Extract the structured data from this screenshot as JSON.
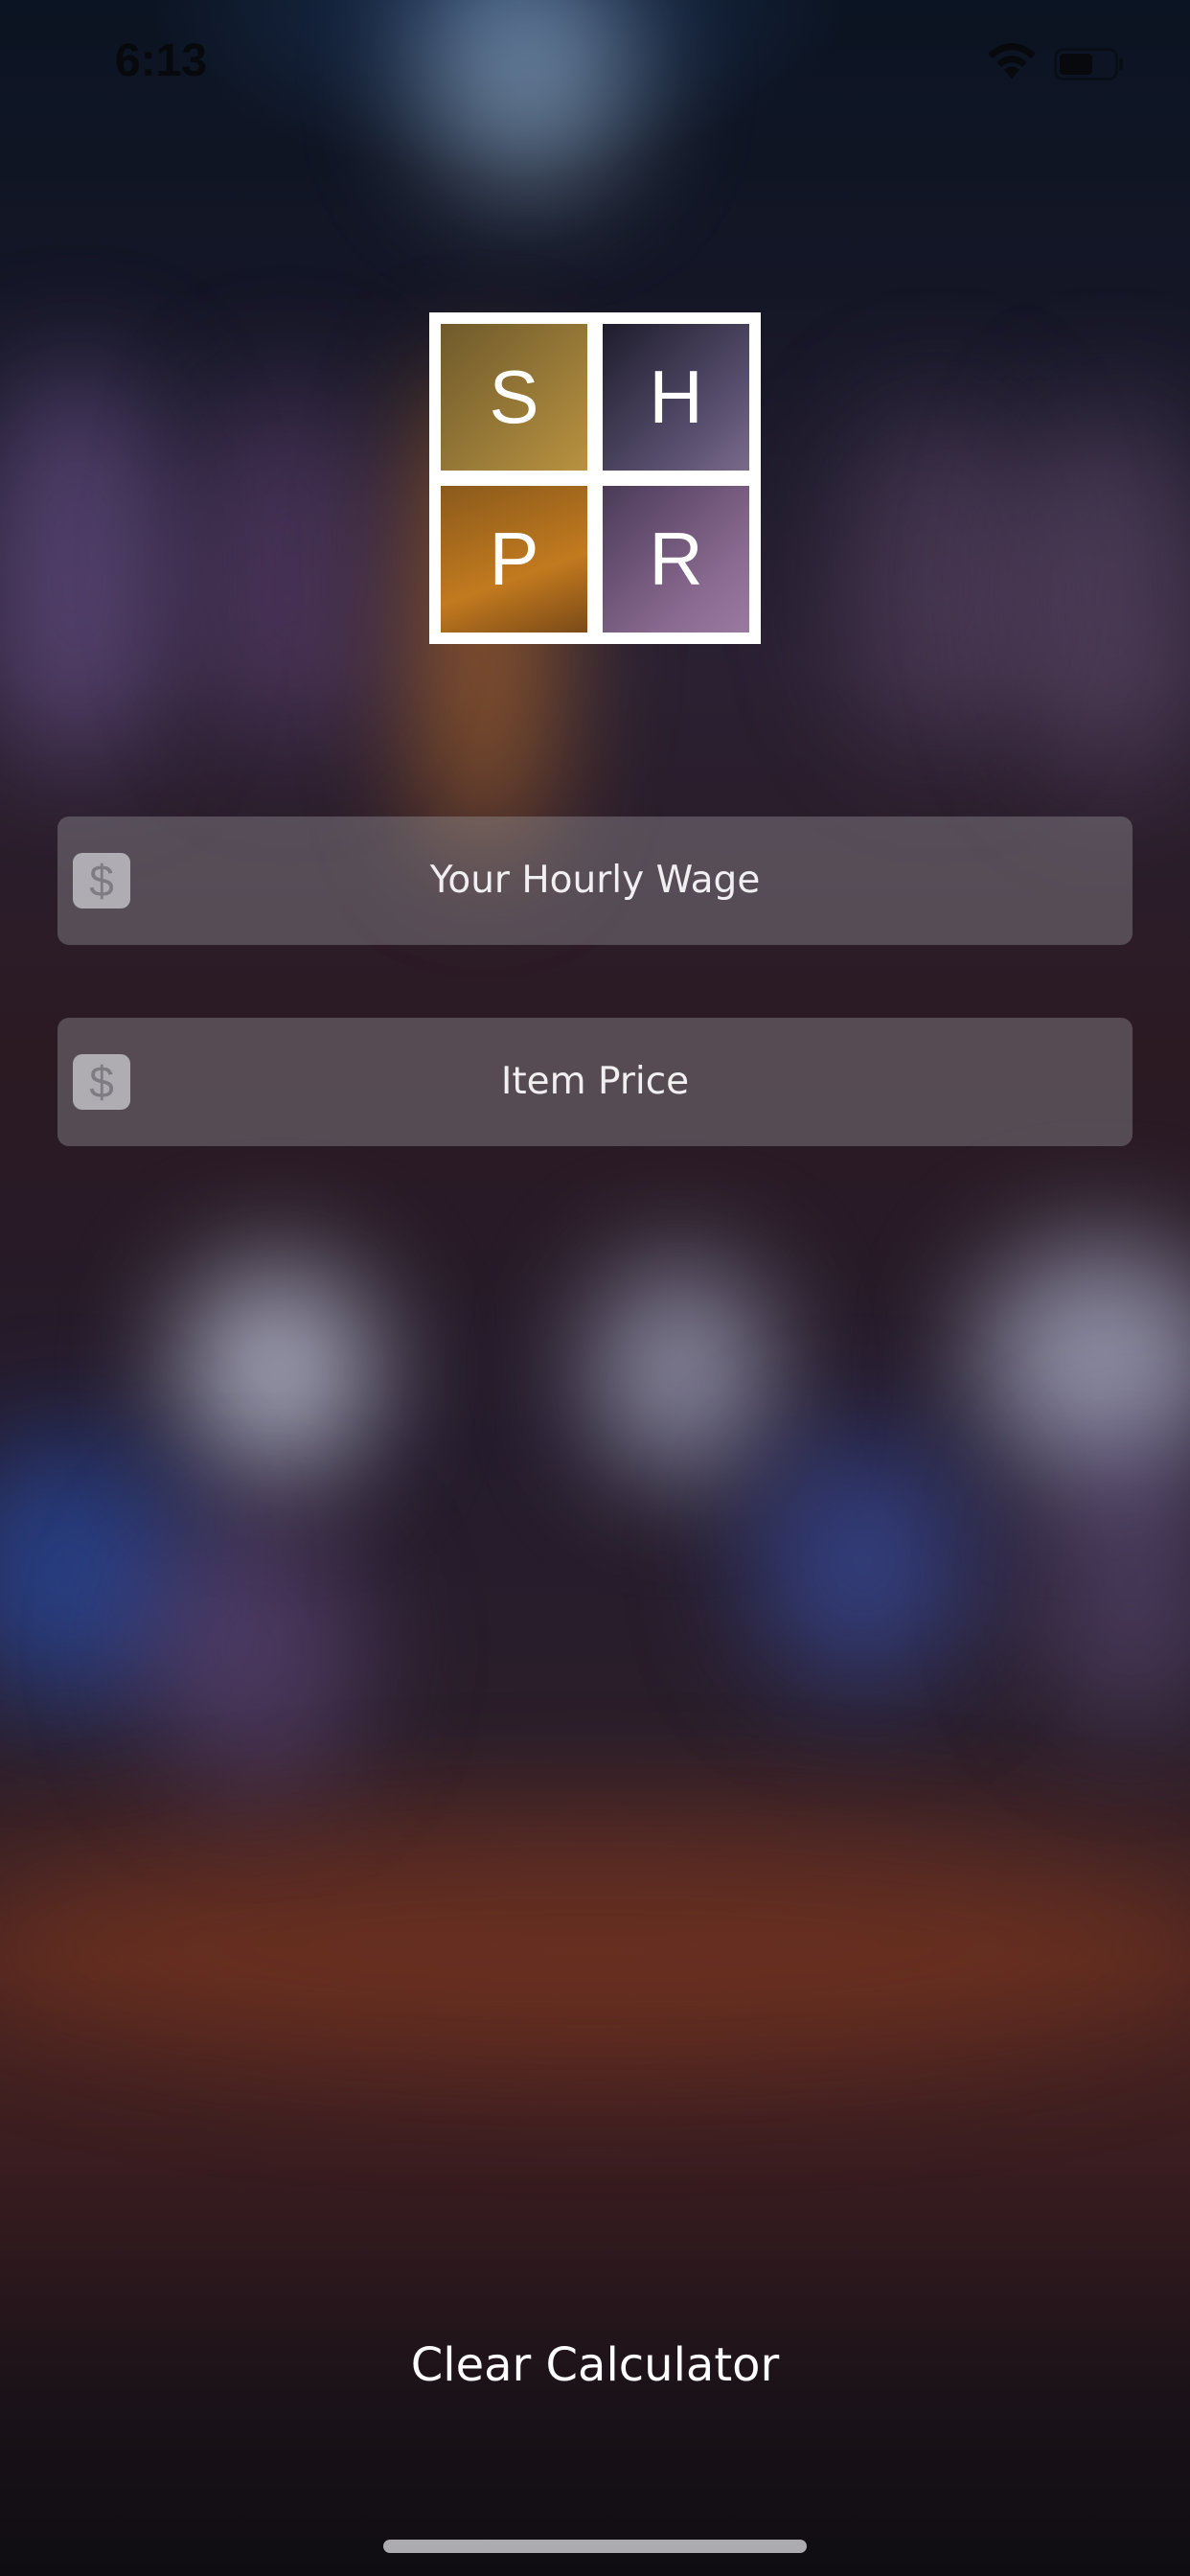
{
  "status_bar": {
    "time": "6:13"
  },
  "logo": {
    "letters": [
      "S",
      "H",
      "P",
      "R"
    ]
  },
  "fields": [
    {
      "icon": "dollar-icon",
      "glyph": "$",
      "label": "Your Hourly Wage"
    },
    {
      "icon": "dollar-icon",
      "glyph": "$",
      "label": "Item Price"
    }
  ],
  "actions": {
    "clear_label": "Clear Calculator"
  }
}
